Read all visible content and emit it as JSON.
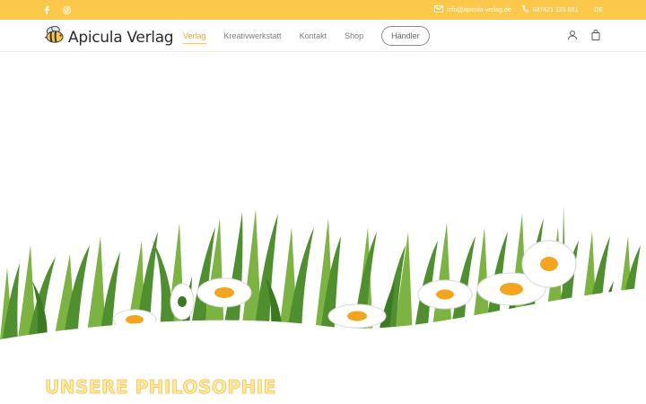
{
  "topbar": {
    "background": "#fbc84b",
    "social_icons": [
      "facebook-icon",
      "instagram-icon"
    ],
    "email": "info@apicula-verlag.de",
    "phone": "037421 123 881",
    "language": "DE"
  },
  "header": {
    "logo_text": "Apicula Verlag",
    "nav": [
      {
        "label": "Verlag",
        "active": true
      },
      {
        "label": "Kreativwerkstatt",
        "active": false
      },
      {
        "label": "Kontakt",
        "active": false
      },
      {
        "label": "Shop",
        "active": false
      }
    ],
    "haendler_label": "Händler",
    "icons": [
      "account-icon",
      "shopping-bag-icon"
    ],
    "accent": "#e6a92a"
  },
  "hero": {
    "image": "meadow-grass-daisies-illustration",
    "grass_color": "#4f8f2f",
    "flower_center_color": "#f3a51f"
  },
  "section": {
    "heading": "UNSERE PHILOSOPHIE",
    "heading_color": "#f3c24b"
  }
}
